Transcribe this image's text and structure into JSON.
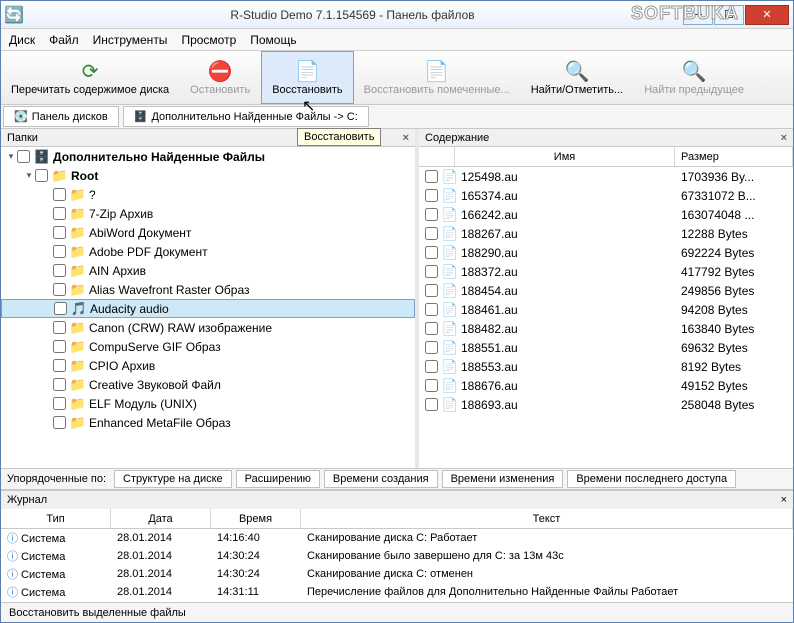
{
  "title": "R-Studio Demo 7.1.154569 - Панель файлов",
  "watermark": "SOFTBUKA",
  "menu": {
    "disk": "Диск",
    "file": "Файл",
    "tools": "Инструменты",
    "view": "Просмотр",
    "help": "Помощь"
  },
  "toolbar": {
    "refresh": "Перечитать содержимое диска",
    "stop": "Остановить",
    "recover": "Восстановить",
    "recover_marked": "Восстановить помеченные...",
    "find": "Найти/Отметить...",
    "find_prev": "Найти предыдущее"
  },
  "tabs": {
    "disks": "Панель дисков",
    "extra_files": "Дополнительно Найденные Файлы -> С:"
  },
  "tooltip": "Восстановить",
  "left": {
    "header_title": "Папки",
    "root1": "Дополнительно Найденные Файлы",
    "root2": "Root",
    "items": [
      "?",
      "7-Zip Архив",
      "AbiWord Документ",
      "Adobe PDF Документ",
      "AIN Архив",
      "Alias Wavefront Raster Образ",
      "Audacity audio",
      "Canon (CRW) RAW изображение",
      "CompuServe GIF Образ",
      "CPIO Архив",
      "Creative Звуковой Файл",
      "ELF Модуль (UNIX)",
      "Enhanced MetaFile Образ"
    ],
    "selected_index": 6
  },
  "right": {
    "header_title": "Содержание",
    "col_name": "Имя",
    "col_size": "Размер",
    "files": [
      {
        "name": "125498.au",
        "size": "1703936 By..."
      },
      {
        "name": "165374.au",
        "size": "67331072 B..."
      },
      {
        "name": "166242.au",
        "size": "163074048 ..."
      },
      {
        "name": "188267.au",
        "size": "12288 Bytes"
      },
      {
        "name": "188290.au",
        "size": "692224 Bytes"
      },
      {
        "name": "188372.au",
        "size": "417792 Bytes"
      },
      {
        "name": "188454.au",
        "size": "249856 Bytes"
      },
      {
        "name": "188461.au",
        "size": "94208 Bytes"
      },
      {
        "name": "188482.au",
        "size": "163840 Bytes"
      },
      {
        "name": "188551.au",
        "size": "69632 Bytes"
      },
      {
        "name": "188553.au",
        "size": "8192 Bytes"
      },
      {
        "name": "188676.au",
        "size": "49152 Bytes"
      },
      {
        "name": "188693.au",
        "size": "258048 Bytes"
      }
    ]
  },
  "sort": {
    "label": "Упорядоченные по:",
    "by_structure": "Структуре на диске",
    "by_ext": "Расширению",
    "by_created": "Времени создания",
    "by_modified": "Времени изменения",
    "by_accessed": "Времени последнего доступа"
  },
  "log": {
    "title": "Журнал",
    "cols": {
      "type": "Тип",
      "date": "Дата",
      "time": "Время",
      "text": "Текст"
    },
    "rows": [
      {
        "type": "Система",
        "date": "28.01.2014",
        "time": "14:16:40",
        "text": "Сканирование диска C: Работает"
      },
      {
        "type": "Система",
        "date": "28.01.2014",
        "time": "14:30:24",
        "text": "Сканирование было завершено для C: за 13м 43с"
      },
      {
        "type": "Система",
        "date": "28.01.2014",
        "time": "14:30:24",
        "text": "Сканирование диска C: отменен"
      },
      {
        "type": "Система",
        "date": "28.01.2014",
        "time": "14:31:11",
        "text": "Перечисление файлов для Дополнительно Найденные Файлы Работает"
      }
    ]
  },
  "status": "Восстановить выделенные файлы"
}
